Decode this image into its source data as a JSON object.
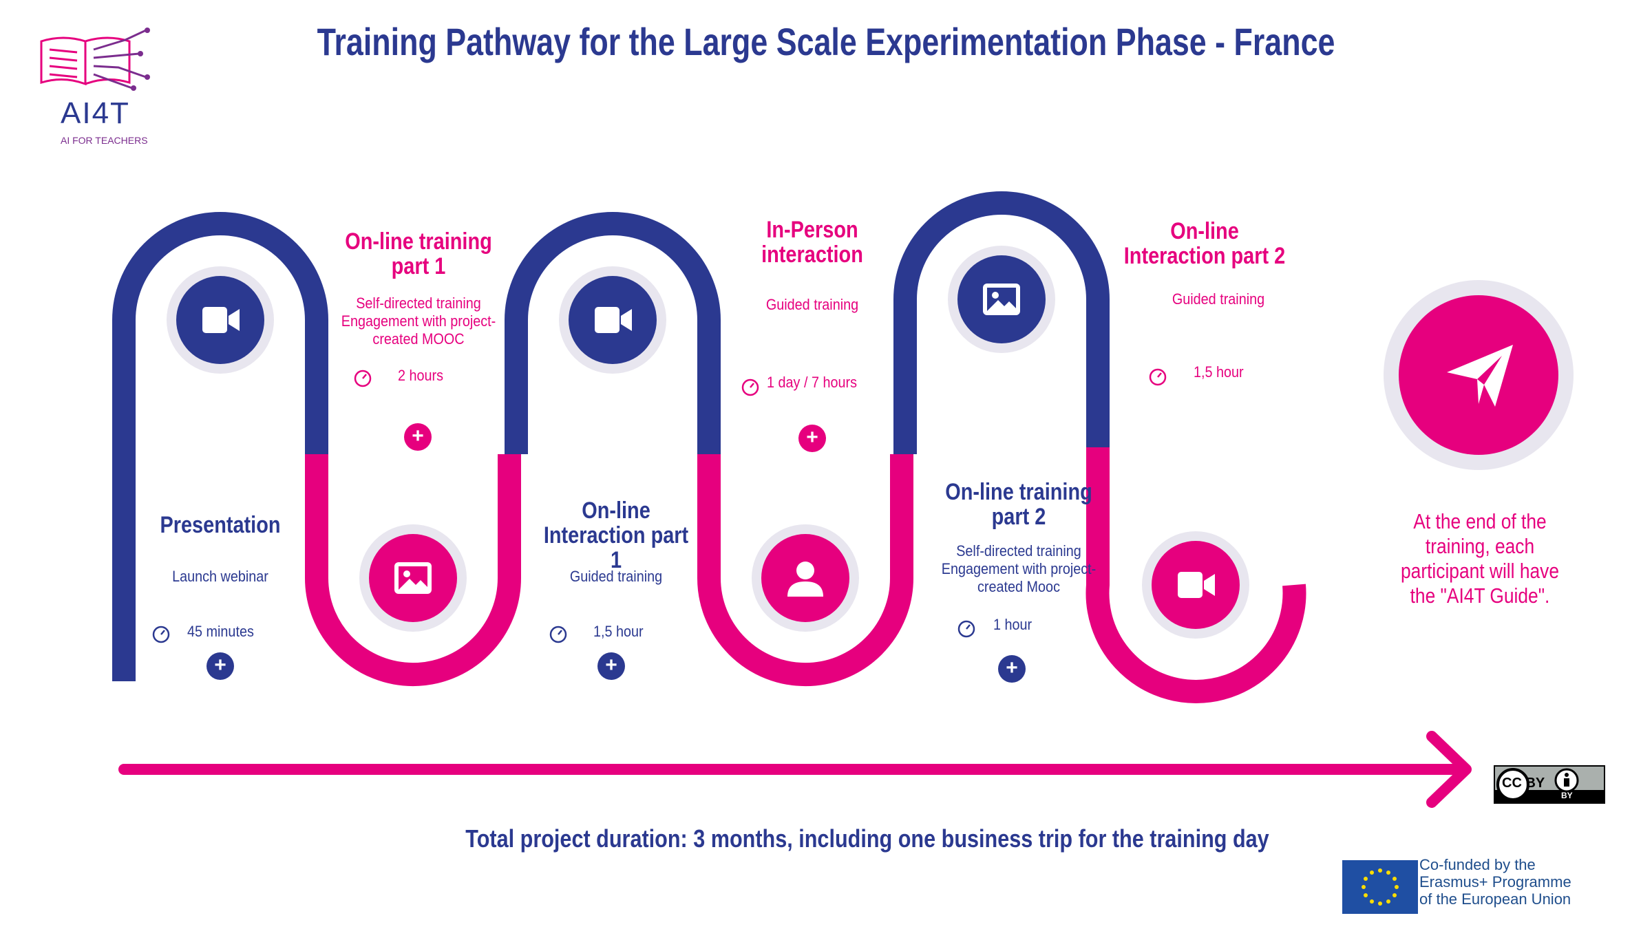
{
  "title": "Training Pathway for the Large Scale Experimentation Phase - France",
  "logo": {
    "name": "AI4T",
    "tagline": "AI FOR TEACHERS"
  },
  "colors": {
    "navy": "#2b3990",
    "pink": "#e6007e",
    "ring_gray": "#e8e6ef"
  },
  "steps": [
    {
      "title": "Presentation",
      "description": "Launch webinar",
      "duration": "45 minutes",
      "icon": "video-icon"
    },
    {
      "title": "On-line training part 1",
      "description": "Self-directed training Engagement with project-created MOOC",
      "duration": "2  hours",
      "icon": "image-icon"
    },
    {
      "title": "On-line Interaction part 1",
      "description": "Guided training",
      "duration": "1,5 hour",
      "icon": "video-icon"
    },
    {
      "title": "In-Person interaction",
      "description": "Guided training",
      "duration": "1 day / 7 hours",
      "icon": "person-icon"
    },
    {
      "title": "On-line training part 2",
      "description": "Self-directed training Engagement with project-created Mooc",
      "duration": "1  hour",
      "icon": "image-icon"
    },
    {
      "title": "On-line Interaction part 2",
      "description": "Guided training",
      "duration": "1,5 hour",
      "icon": "video-icon"
    }
  ],
  "plus_label": "+",
  "end_message": "At the end of the training, each participant will have the \"AI4T Guide\".",
  "end_icon": "paper-plane-icon",
  "total_duration": "Total project duration: 3 months, including one business trip for the training day",
  "license": {
    "name": "CC BY",
    "sub": "BY"
  },
  "eu": {
    "text": "Co-funded by the Erasmus+ Programme of the European Union"
  }
}
